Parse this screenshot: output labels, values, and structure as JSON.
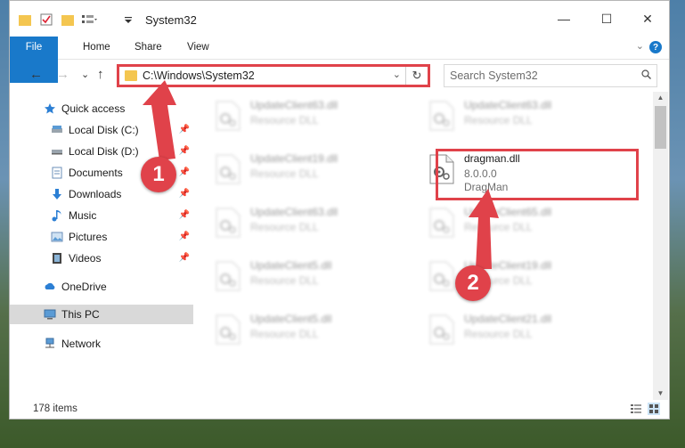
{
  "window": {
    "title": "System32",
    "minimize_glyph": "—",
    "maximize_glyph": "☐",
    "close_glyph": "✕"
  },
  "ribbon": {
    "tabs": [
      "File",
      "Home",
      "Share",
      "View"
    ],
    "help_glyph": "?",
    "expand_glyph": "⌄"
  },
  "toolbar": {
    "back_glyph": "←",
    "forward_glyph": "→",
    "recent_glyph": "⌄",
    "up_glyph": "↑"
  },
  "address": {
    "path": "C:\\Windows\\System32",
    "dropdown_glyph": "⌄",
    "refresh_glyph": "↻"
  },
  "search": {
    "placeholder": "Search System32"
  },
  "nav": {
    "items": [
      {
        "label": "Quick access",
        "icon": "star-icon"
      },
      {
        "label": "Local Disk (C:)",
        "icon": "drive-icon",
        "pinned": true
      },
      {
        "label": "Local Disk (D:)",
        "icon": "drive-icon",
        "pinned": true
      },
      {
        "label": "Documents",
        "icon": "documents-icon",
        "pinned": true
      },
      {
        "label": "Downloads",
        "icon": "downloads-icon",
        "pinned": true
      },
      {
        "label": "Music",
        "icon": "music-icon",
        "pinned": true
      },
      {
        "label": "Pictures",
        "icon": "pictures-icon",
        "pinned": true
      },
      {
        "label": "Videos",
        "icon": "videos-icon",
        "pinned": true
      },
      {
        "label": "OneDrive",
        "icon": "cloud-icon"
      },
      {
        "label": "This PC",
        "icon": "computer-icon",
        "selected": true
      },
      {
        "label": "Network",
        "icon": "network-icon"
      }
    ],
    "pin_glyph": "📌"
  },
  "files": [
    {
      "name": "UpdateClient63.dll",
      "desc": "Resource DLL",
      "blurred": true
    },
    {
      "name": "UpdateClient63.dll",
      "desc": "Resource DLL",
      "blurred": true
    },
    {
      "name": "UpdateClient19.dll",
      "desc": "Resource DLL",
      "blurred": true
    },
    {
      "name": "dragman.dll",
      "desc": "8.0.0.0",
      "desc2": "DragMan",
      "blurred": false
    },
    {
      "name": "UpdateClient63.dll",
      "desc": "Resource DLL",
      "blurred": true
    },
    {
      "name": "UpdateClient65.dll",
      "desc": "Resource DLL",
      "blurred": true
    },
    {
      "name": "UpdateClient5.dll",
      "desc": "Resource DLL",
      "blurred": true
    },
    {
      "name": "UpdateClient19.dll",
      "desc": "Resource DLL",
      "blurred": true
    },
    {
      "name": "UpdateClient5.dll",
      "desc": "Resource DLL",
      "blurred": true
    },
    {
      "name": "UpdateClient21.dll",
      "desc": "Resource DLL",
      "blurred": true
    }
  ],
  "status": {
    "item_count": "178 items"
  },
  "annotations": {
    "step1": "1",
    "step2": "2",
    "color": "#e0424a"
  },
  "colors": {
    "accent": "#1979ca",
    "highlight": "#e0424a",
    "folder": "#f4c650"
  }
}
